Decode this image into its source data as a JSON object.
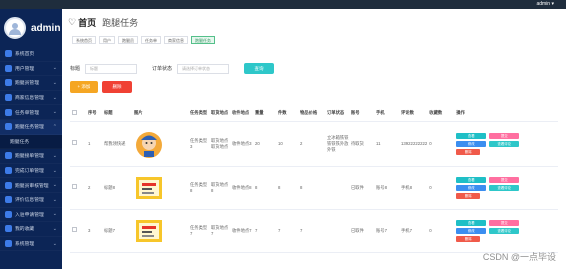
{
  "topbar": {
    "user": "admin ▾"
  },
  "sidebar": {
    "app_title": "admin",
    "items": [
      {
        "label": "系统首页",
        "arrow": "",
        "active": false,
        "sub": false
      },
      {
        "label": "用户管理",
        "arrow": "⌄",
        "active": false,
        "sub": false
      },
      {
        "label": "跑腿员管理",
        "arrow": "⌄",
        "active": false,
        "sub": false
      },
      {
        "label": "商家信息管理",
        "arrow": "⌄",
        "active": false,
        "sub": false
      },
      {
        "label": "任务单管理",
        "arrow": "⌄",
        "active": false,
        "sub": false
      },
      {
        "label": "跑腿任务管理",
        "arrow": "⌃",
        "active": true,
        "sub": false
      },
      {
        "label": "跑腿任务",
        "arrow": "",
        "active": false,
        "sub": true
      },
      {
        "label": "跑腿接单管理",
        "arrow": "⌄",
        "active": false,
        "sub": false
      },
      {
        "label": "完成订单管理",
        "arrow": "⌄",
        "active": false,
        "sub": false
      },
      {
        "label": "跑腿员审核管理",
        "arrow": "⌄",
        "active": false,
        "sub": false
      },
      {
        "label": "评价信息管理",
        "arrow": "⌄",
        "active": false,
        "sub": false
      },
      {
        "label": "入驻申请管理",
        "arrow": "⌄",
        "active": false,
        "sub": false
      },
      {
        "label": "我的收藏",
        "arrow": "⌄",
        "active": false,
        "sub": false
      },
      {
        "label": "系统管理",
        "arrow": "⌄",
        "active": false,
        "sub": false
      }
    ]
  },
  "header": {
    "heart": "♡",
    "home": "首页",
    "current": "跑腿任务"
  },
  "tags": [
    "系统首页",
    "用户",
    "跑腿员",
    "任务单",
    "商家信息",
    "跑腿任务"
  ],
  "search": {
    "label1": "标题",
    "placeholder1": "标题",
    "label2": "订单状态",
    "placeholder2": "请选择订单状态",
    "button": "查询"
  },
  "actions": {
    "add": "+ 添加",
    "delete": "删除"
  },
  "table": {
    "headers": [
      "",
      "序号",
      "标题",
      "图片",
      "任务类型",
      "取货地点",
      "收件地点",
      "重量",
      "件数",
      "物品价格",
      "订单状态",
      "账号",
      "手机",
      "评论数",
      "收藏数",
      "操作"
    ],
    "rows": [
      {
        "no": "1",
        "title": "帮我领快递",
        "type": "任务类型3",
        "pickup": "取货地点取货地点",
        "dest": "收件地点3",
        "weight": "20",
        "count": "10",
        "price": "2",
        "status_note": "立冰箱铁铁铁铁铁外放外铁",
        "status": "待取货",
        "account": "11",
        "phone": "13922222222",
        "comments": "0",
        "favs": "0"
      },
      {
        "no": "2",
        "title": "标题8",
        "type": "任务类型8",
        "pickup": "取货地点8",
        "dest": "收件地点8",
        "weight": "8",
        "count": "8",
        "price": "8",
        "status_note": "",
        "status": "已取件",
        "account": "账号8",
        "phone": "手机8",
        "comments": "0",
        "favs": "8"
      },
      {
        "no": "3",
        "title": "标题7",
        "type": "任务类型7",
        "pickup": "取货地点7",
        "dest": "收件地点7",
        "weight": "7",
        "count": "7",
        "price": "7",
        "status_note": "",
        "status": "已取件",
        "account": "账号7",
        "phone": "手机7",
        "comments": "0",
        "favs": "7"
      }
    ],
    "ops": {
      "view": "查看",
      "submit": "提交",
      "edit": "修改",
      "review": "查看评论",
      "delete": "删除"
    }
  },
  "watermark": "CSDN @一点毕设"
}
